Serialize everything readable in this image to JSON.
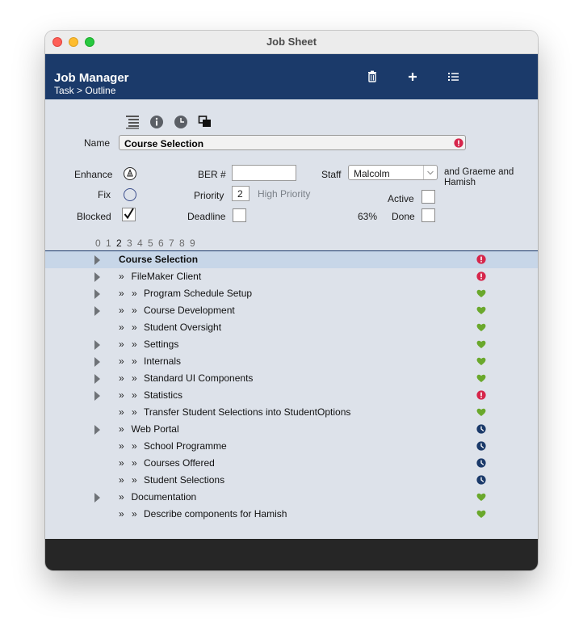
{
  "window": {
    "title": "Job Sheet"
  },
  "header": {
    "title": "Job Manager",
    "breadcrumb": "Task > Outline",
    "actions": [
      {
        "name": "delete",
        "icon": "trash-icon"
      },
      {
        "name": "add",
        "icon": "plus-icon"
      },
      {
        "name": "list",
        "icon": "list-icon"
      }
    ]
  },
  "toolbar": {
    "icons": [
      "outline-icon",
      "info-icon",
      "clock-icon",
      "copy-icon"
    ]
  },
  "form": {
    "name_label": "Name",
    "name_value": "Course Selection",
    "enhance_label": "Enhance",
    "fix_label": "Fix",
    "blocked_label": "Blocked",
    "blocked_checked": true,
    "ber_label": "BER #",
    "ber_value": "",
    "priority_label": "Priority",
    "priority_value": "2",
    "priority_text": "High Priority",
    "deadline_label": "Deadline",
    "staff_label": "Staff",
    "staff_value": "Malcolm",
    "staff_extra": "and Graeme and Hamish",
    "active_label": "Active",
    "progress_text": "63%",
    "done_label": "Done"
  },
  "outline": {
    "levels": [
      "0",
      "1",
      "2",
      "3",
      "4",
      "5",
      "6",
      "7",
      "8",
      "9"
    ],
    "current_level": "2",
    "rows": [
      {
        "label": "Course Selection",
        "depth": 0,
        "expandable": true,
        "status": "alert",
        "selected": true
      },
      {
        "label": "FileMaker Client",
        "depth": 1,
        "expandable": true,
        "status": "alert"
      },
      {
        "label": "Program Schedule Setup",
        "depth": 2,
        "expandable": true,
        "status": "heart"
      },
      {
        "label": "Course Development",
        "depth": 2,
        "expandable": true,
        "status": "heart"
      },
      {
        "label": "Student Oversight",
        "depth": 2,
        "expandable": false,
        "status": "heart"
      },
      {
        "label": "Settings",
        "depth": 2,
        "expandable": true,
        "status": "heart"
      },
      {
        "label": "Internals",
        "depth": 2,
        "expandable": true,
        "status": "heart"
      },
      {
        "label": "Standard UI Components",
        "depth": 2,
        "expandable": true,
        "status": "heart"
      },
      {
        "label": "Statistics",
        "depth": 2,
        "expandable": true,
        "status": "alert"
      },
      {
        "label": "Transfer Student Selections into StudentOptions",
        "depth": 2,
        "expandable": false,
        "status": "heart"
      },
      {
        "label": "Web Portal",
        "depth": 1,
        "expandable": true,
        "status": "clock"
      },
      {
        "label": "School Programme",
        "depth": 2,
        "expandable": false,
        "status": "clock"
      },
      {
        "label": "Courses Offered",
        "depth": 2,
        "expandable": false,
        "status": "clock"
      },
      {
        "label": "Student Selections",
        "depth": 2,
        "expandable": false,
        "status": "clock"
      },
      {
        "label": "Documentation",
        "depth": 1,
        "expandable": true,
        "status": "heart"
      },
      {
        "label": "Describe components for Hamish",
        "depth": 2,
        "expandable": false,
        "status": "heart"
      }
    ]
  },
  "colors": {
    "header_bg": "#1b3a6a",
    "selected_row": "#c7d6e8",
    "alert": "#d6264b",
    "heart": "#6aa82c",
    "clock": "#1b3a6a"
  }
}
